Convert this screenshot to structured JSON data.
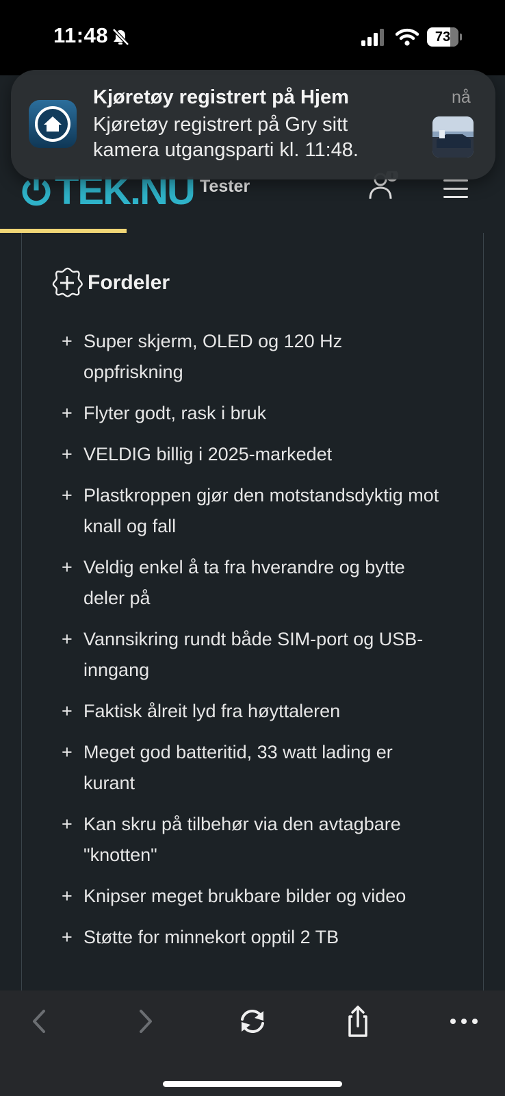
{
  "status_bar": {
    "time": "11:48",
    "battery_percent": 73,
    "battery_label": "73"
  },
  "notification": {
    "title": "Kjøretøy registrert på Hjem",
    "time": "nå",
    "body": "Kjøretøy registrert på Gry sitt kamera utgangsparti kl. 11:48.",
    "app_icon": "home-icon"
  },
  "site": {
    "logo": "TEK.NU",
    "nav_label": "Tester",
    "brand_color": "#2fb3c9",
    "reading_progress_percent": 25
  },
  "section": {
    "title": "Fordeler",
    "icon": "plus-badge-icon",
    "mark": "+",
    "items": [
      "Super skjerm, OLED og 120 Hz oppfriskning",
      "Flyter godt, rask i bruk",
      "VELDIG billig i 2025-markedet",
      "Plastkroppen gjør den motstandsdyktig mot knall og fall",
      "Veldig enkel å ta fra hverandre og bytte deler på",
      "Vannsikring rundt både SIM-port og USB-inngang",
      "Faktisk ålreit lyd fra høyttaleren",
      "Meget god batteritid, 33 watt lading er kurant",
      "Kan skru på tilbehør via den avtagbare \"knotten\"",
      "Knipser meget brukbare bilder og video",
      "Støtte for minnekort opptil 2 TB"
    ]
  },
  "toolbar": {
    "icons": [
      "back-icon",
      "forward-icon",
      "reload-icon",
      "share-icon",
      "more-icon"
    ]
  }
}
